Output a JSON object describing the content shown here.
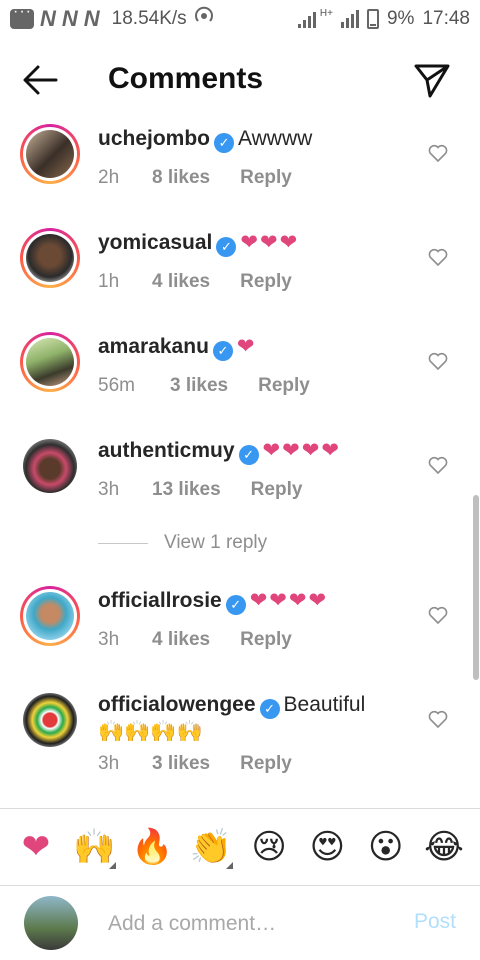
{
  "status_bar": {
    "network_letters": [
      "N",
      "N",
      "N"
    ],
    "speed": "18.54K/s",
    "battery": "9%",
    "time": "17:48",
    "network_type": "H+"
  },
  "header": {
    "title": "Comments"
  },
  "colors": {
    "verified": "#3897f0",
    "heart": "#e0457b",
    "post_disabled": "#b2dffc",
    "meta_gray": "#8e8e8e"
  },
  "comments": [
    {
      "username": "uchejombo",
      "text": "Awwww",
      "time": "2h",
      "likes": "8 likes",
      "reply": "Reply"
    },
    {
      "username": "yomicasual",
      "text": "❤❤❤",
      "time": "1h",
      "likes": "4 likes",
      "reply": "Reply"
    },
    {
      "username": "amarakanu",
      "text": "❤",
      "time": "56m",
      "likes": "3 likes",
      "reply": "Reply"
    },
    {
      "username": "authenticmuy",
      "text": "❤❤❤❤",
      "time": "3h",
      "likes": "13 likes",
      "reply": "Reply"
    },
    {
      "username": "officiallrosie",
      "text": "❤❤❤❤",
      "time": "3h",
      "likes": "4 likes",
      "reply": "Reply"
    },
    {
      "username": "officialowengee",
      "text": "Beautiful",
      "text2": "🙌🙌🙌🙌",
      "time": "3h",
      "likes": "3 likes",
      "reply": "Reply"
    }
  ],
  "view_replies": "View 1 reply",
  "emoji_bar": [
    "❤",
    "🙌",
    "🔥",
    "👏",
    "😢",
    "😍",
    "😮",
    "😂"
  ],
  "input": {
    "placeholder": "Add a comment…",
    "post_label": "Post"
  }
}
